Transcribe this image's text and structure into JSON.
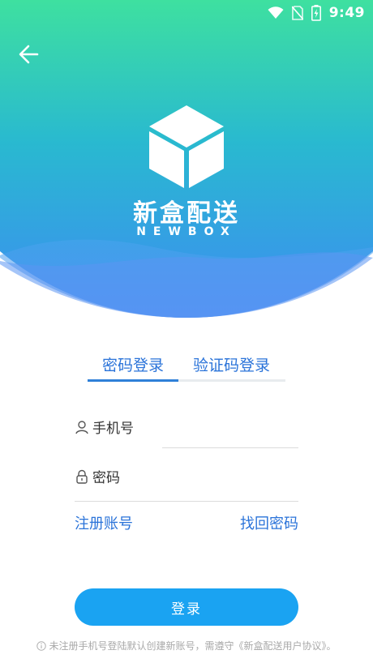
{
  "statusbar": {
    "time": "9:49",
    "icons": [
      "wifi-icon",
      "no-sim-icon",
      "battery-charging-icon"
    ]
  },
  "header": {
    "back_icon": "arrow-left-icon",
    "logo_icon": "cube-icon",
    "brand_name": "新盒配送",
    "brand_english": "NEWBOX"
  },
  "tabs": [
    {
      "label": "密码登录",
      "active": true
    },
    {
      "label": "验证码登录",
      "active": false
    }
  ],
  "form": {
    "phone_label": "手机号",
    "phone_icon": "user-icon",
    "password_label": "密码",
    "password_icon": "lock-icon"
  },
  "links": {
    "register": "注册账号",
    "forgot": "找回密码"
  },
  "login_button": "登录",
  "notice": {
    "icon": "info-icon",
    "text": "未注册手机号登陆默认创建新账号，需遵守《新盒配送用户协议》。"
  },
  "colors": {
    "gradient_top": "#3ee0a0",
    "gradient_bottom": "#3d8cf2",
    "accent": "#2a73d9",
    "button": "#1aa3f2"
  }
}
